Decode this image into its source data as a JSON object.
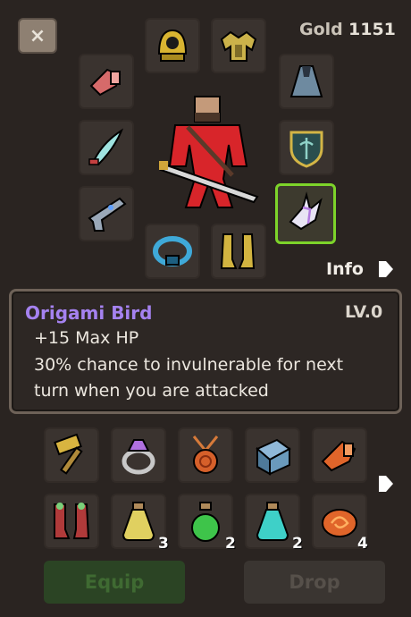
{
  "header": {
    "close_icon": "×",
    "gold_label": "Gold",
    "gold_value": "1151"
  },
  "equipment": {
    "slots": [
      {
        "name": "helmet-slot",
        "icon": "gold-helmet-icon"
      },
      {
        "name": "shoulder-armor-slot",
        "icon": "gold-shoulder-armor-icon"
      },
      {
        "name": "gauntlet-slot",
        "icon": "red-gauntlet-icon"
      },
      {
        "name": "cloak-slot",
        "icon": "cloak-icon"
      },
      {
        "name": "weapon-slot",
        "icon": "curved-blade-icon"
      },
      {
        "name": "shield-slot",
        "icon": "shield-icon"
      },
      {
        "name": "gun-slot",
        "icon": "pistol-icon"
      },
      {
        "name": "accessory-slot",
        "icon": "origami-bird-icon",
        "selected": true
      },
      {
        "name": "belt-slot",
        "icon": "blue-belt-icon"
      },
      {
        "name": "boots-slot",
        "icon": "gold-boots-icon"
      }
    ],
    "accent_color": "#7dd42a"
  },
  "info": {
    "label": "Info"
  },
  "tooltip": {
    "item_name": "Origami Bird",
    "level": "LV.0",
    "lines": [
      "+15 Max HP",
      "30% chance to invulnerable for next",
      "turn when you are attacked"
    ],
    "name_color": "#a582f0"
  },
  "inventory": {
    "items": [
      {
        "icon": "hammer-icon"
      },
      {
        "icon": "crystal-ring-icon"
      },
      {
        "icon": "amulet-icon"
      },
      {
        "icon": "cube-device-icon"
      },
      {
        "icon": "orange-gauntlet-icon"
      },
      {
        "icon": "red-boots-icon"
      },
      {
        "icon": "yellow-potion-icon",
        "count": "3"
      },
      {
        "icon": "green-potion-icon",
        "count": "2"
      },
      {
        "icon": "cyan-potion-icon",
        "count": "2"
      },
      {
        "icon": "orange-stone-icon",
        "count": "4"
      }
    ]
  },
  "actions": {
    "equip_label": "Equip",
    "drop_label": "Drop"
  }
}
